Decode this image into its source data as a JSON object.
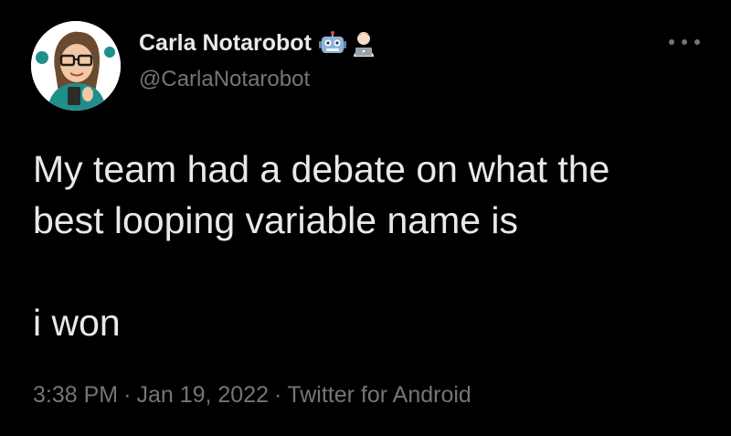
{
  "tweet": {
    "author": {
      "display_name": "Carla Notarobot",
      "handle": "@CarlaNotarobot",
      "name_emojis": [
        "robot-face-emoji",
        "technologist-emoji"
      ],
      "avatar": "avatar-cartoon-woman-with-glasses"
    },
    "more_icon": "more-horizontal-icon",
    "text_lines": [
      "My team had a debate on what the",
      "best looping variable name is",
      "i won"
    ],
    "meta": {
      "time": "3:38 PM",
      "separator": "·",
      "date": "Jan 19, 2022",
      "source": "Twitter for Android"
    }
  },
  "colors": {
    "background": "#000000",
    "text_primary": "#e7e9ea",
    "text_secondary": "#71767b"
  }
}
